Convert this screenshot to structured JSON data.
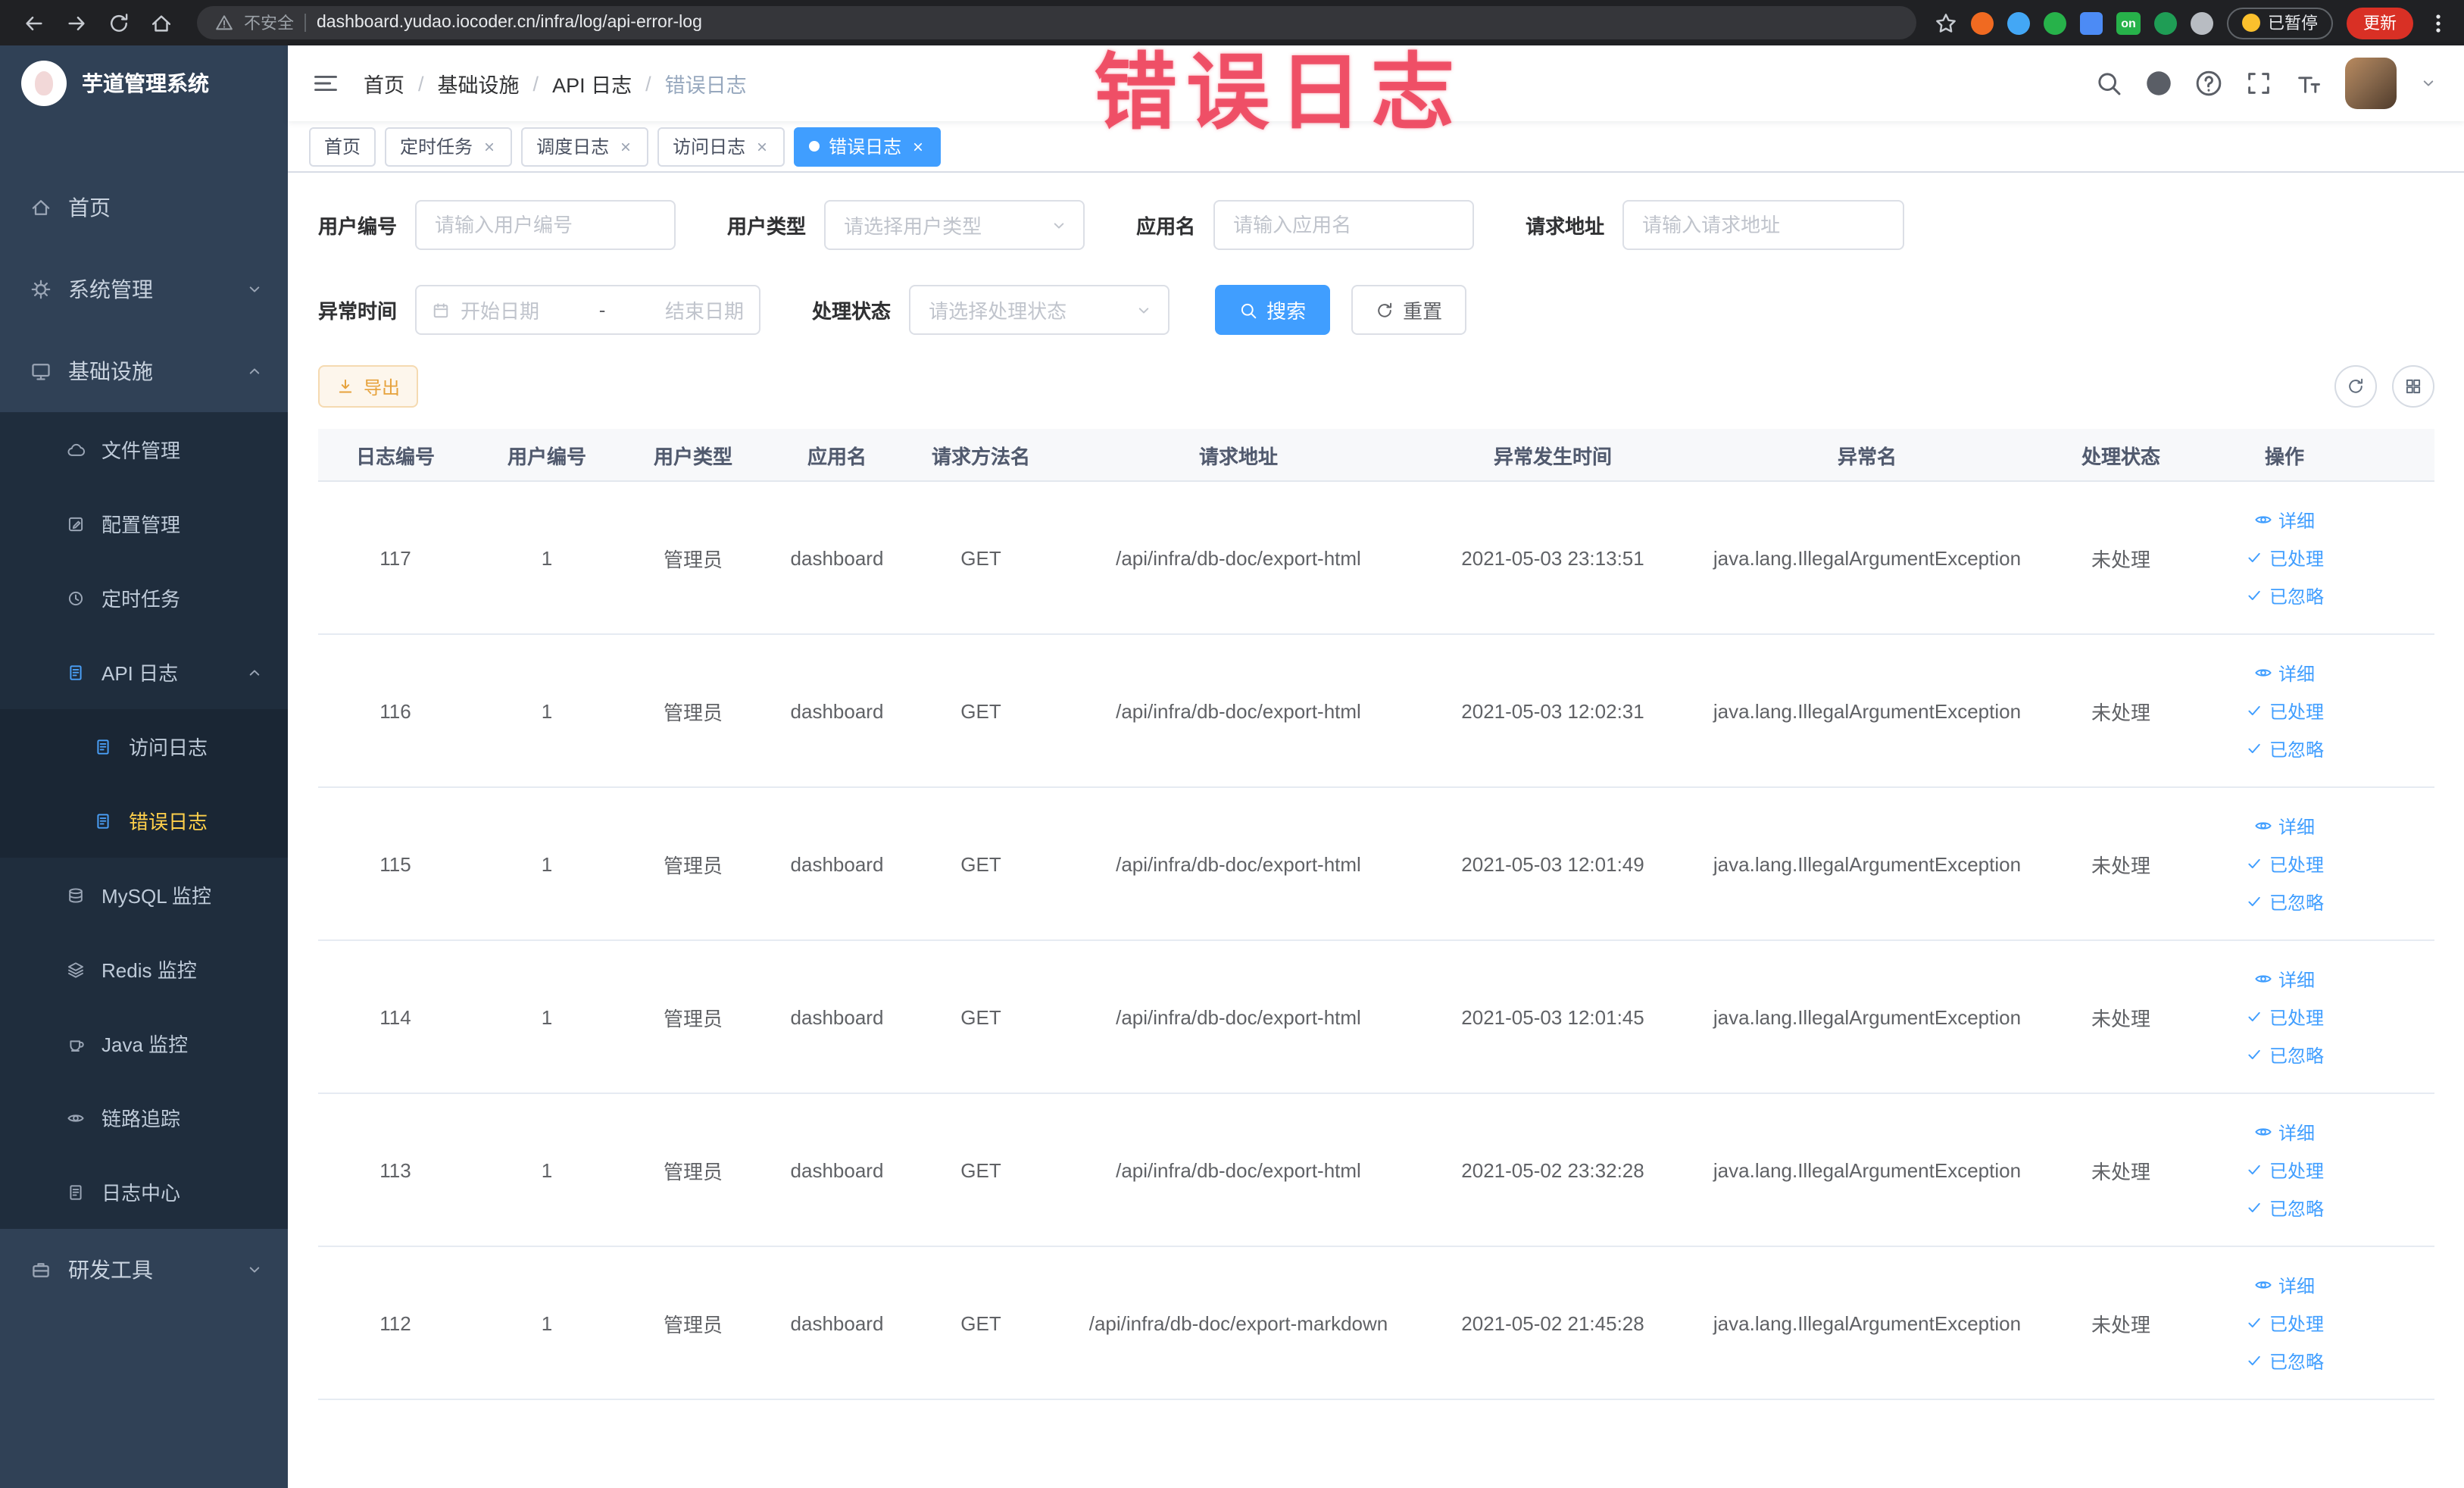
{
  "watermark_text": "错误日志",
  "colors": {
    "primary": "#409eff",
    "sidebar_bg": "#304156",
    "submenu_bg": "#1f2d3d",
    "sidebar_active_text": "#ffd04b",
    "warning_text": "#e6a23c",
    "warning_bg": "#fdf6ec",
    "warning_border": "#f5dab1",
    "watermark": "#ee485f",
    "chrome_bg": "#202124",
    "update_chip_bg": "#d93025",
    "active_tab_bg": "#409eff"
  },
  "browser": {
    "security_label": "不安全",
    "url": "dashboard.yudao.iocoder.cn/infra/log/api-error-log",
    "ext_on_label": "on",
    "paused_label": "已暂停",
    "update_label": "更新"
  },
  "sidebar": {
    "logo_title": "芋道管理系统",
    "items": [
      {
        "label": "首页"
      },
      {
        "label": "系统管理"
      },
      {
        "label": "基础设施"
      },
      {
        "label": "文件管理"
      },
      {
        "label": "配置管理"
      },
      {
        "label": "定时任务"
      },
      {
        "label": "API 日志"
      },
      {
        "label": "访问日志"
      },
      {
        "label": "错误日志"
      },
      {
        "label": "MySQL 监控"
      },
      {
        "label": "Redis 监控"
      },
      {
        "label": "Java 监控"
      },
      {
        "label": "链路追踪"
      },
      {
        "label": "日志中心"
      },
      {
        "label": "研发工具"
      }
    ]
  },
  "navbar": {
    "breadcrumb": [
      "首页",
      "基础设施",
      "API 日志",
      "错误日志"
    ],
    "breadcrumb_separator": "/"
  },
  "tabs": [
    {
      "label": "首页"
    },
    {
      "label": "定时任务"
    },
    {
      "label": "调度日志"
    },
    {
      "label": "访问日志"
    },
    {
      "label": "错误日志"
    }
  ],
  "filters": {
    "user_id_label": "用户编号",
    "user_id_placeholder": "请输入用户编号",
    "user_type_label": "用户类型",
    "user_type_placeholder": "请选择用户类型",
    "app_name_label": "应用名",
    "app_name_placeholder": "请输入应用名",
    "request_url_label": "请求地址",
    "request_url_placeholder": "请输入请求地址",
    "error_time_label": "异常时间",
    "date_start_placeholder": "开始日期",
    "date_separator": "-",
    "date_end_placeholder": "结束日期",
    "status_label": "处理状态",
    "status_placeholder": "请选择处理状态",
    "search_label": "搜索",
    "reset_label": "重置"
  },
  "toolbar": {
    "export_label": "导出"
  },
  "table": {
    "columns": [
      "日志编号",
      "用户编号",
      "用户类型",
      "应用名",
      "请求方法名",
      "请求地址",
      "异常发生时间",
      "异常名",
      "处理状态",
      "操作"
    ],
    "actions": [
      "详细",
      "已处理",
      "已忽略"
    ],
    "rows": [
      {
        "cells": [
          "117",
          "1",
          "管理员",
          "dashboard",
          "GET",
          "/api/infra/db-doc/export-html",
          "2021-05-03 23:13:51",
          "java.lang.IllegalArgumentException",
          "未处理"
        ]
      },
      {
        "cells": [
          "116",
          "1",
          "管理员",
          "dashboard",
          "GET",
          "/api/infra/db-doc/export-html",
          "2021-05-03 12:02:31",
          "java.lang.IllegalArgumentException",
          "未处理"
        ]
      },
      {
        "cells": [
          "115",
          "1",
          "管理员",
          "dashboard",
          "GET",
          "/api/infra/db-doc/export-html",
          "2021-05-03 12:01:49",
          "java.lang.IllegalArgumentException",
          "未处理"
        ]
      },
      {
        "cells": [
          "114",
          "1",
          "管理员",
          "dashboard",
          "GET",
          "/api/infra/db-doc/export-html",
          "2021-05-03 12:01:45",
          "java.lang.IllegalArgumentException",
          "未处理"
        ]
      },
      {
        "cells": [
          "113",
          "1",
          "管理员",
          "dashboard",
          "GET",
          "/api/infra/db-doc/export-html",
          "2021-05-02 23:32:28",
          "java.lang.IllegalArgumentException",
          "未处理"
        ]
      },
      {
        "cells": [
          "112",
          "1",
          "管理员",
          "dashboard",
          "GET",
          "/api/infra/db-doc/export-markdown",
          "2021-05-02 21:45:28",
          "java.lang.IllegalArgumentException",
          "未处理"
        ]
      }
    ]
  }
}
